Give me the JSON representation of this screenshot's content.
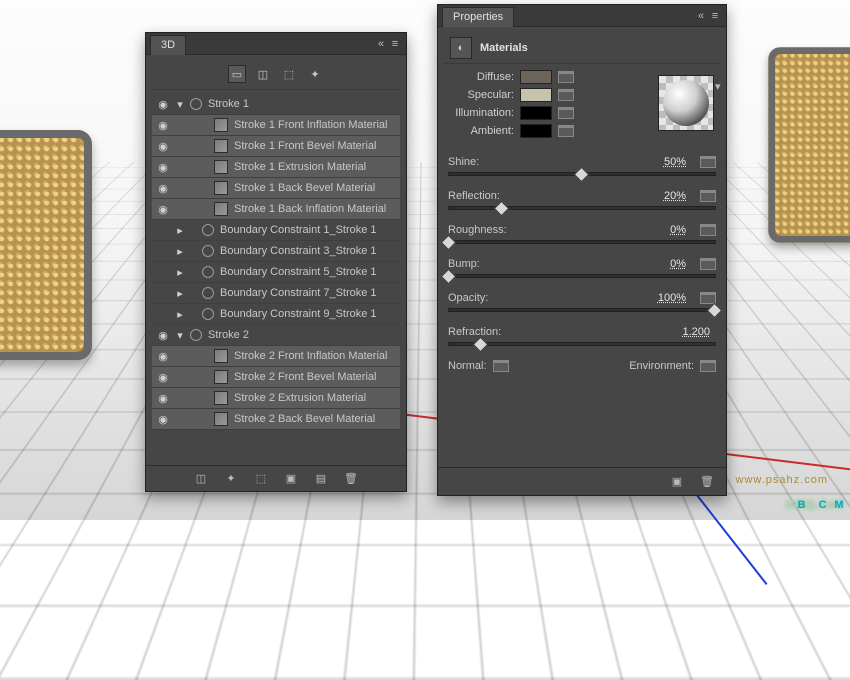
{
  "watermark_main": "UiBQ.CoM",
  "watermark_sub": "www.psahz.com",
  "panels": {
    "threeD": {
      "tab": "3D",
      "tree": [
        {
          "eye": true,
          "chv": "v",
          "depth": 0,
          "icon": "mesh",
          "label": "Stroke 1",
          "sel": false
        },
        {
          "eye": true,
          "chv": "",
          "depth": 2,
          "icon": "mat",
          "label": "Stroke 1 Front Inflation Material",
          "sel": true
        },
        {
          "eye": true,
          "chv": "",
          "depth": 2,
          "icon": "mat",
          "label": "Stroke 1 Front Bevel Material",
          "sel": true
        },
        {
          "eye": true,
          "chv": "",
          "depth": 2,
          "icon": "mat",
          "label": "Stroke 1 Extrusion Material",
          "sel": true
        },
        {
          "eye": true,
          "chv": "",
          "depth": 2,
          "icon": "mat",
          "label": "Stroke 1 Back Bevel Material",
          "sel": true
        },
        {
          "eye": true,
          "chv": "",
          "depth": 2,
          "icon": "mat",
          "label": "Stroke 1 Back Inflation Material",
          "sel": true
        },
        {
          "eye": false,
          "chv": ">",
          "depth": 1,
          "icon": "mesh",
          "label": "Boundary Constraint 1_Stroke 1",
          "sel": false
        },
        {
          "eye": false,
          "chv": ">",
          "depth": 1,
          "icon": "mesh",
          "label": "Boundary Constraint 3_Stroke 1",
          "sel": false
        },
        {
          "eye": false,
          "chv": ">",
          "depth": 1,
          "icon": "mesh",
          "label": "Boundary Constraint 5_Stroke 1",
          "sel": false
        },
        {
          "eye": false,
          "chv": ">",
          "depth": 1,
          "icon": "mesh",
          "label": "Boundary Constraint 7_Stroke 1",
          "sel": false
        },
        {
          "eye": false,
          "chv": ">",
          "depth": 1,
          "icon": "mesh",
          "label": "Boundary Constraint 9_Stroke 1",
          "sel": false
        },
        {
          "eye": true,
          "chv": "v",
          "depth": 0,
          "icon": "mesh",
          "label": "Stroke 2",
          "sel": false
        },
        {
          "eye": true,
          "chv": "",
          "depth": 2,
          "icon": "mat",
          "label": "Stroke 2 Front Inflation Material",
          "sel": true
        },
        {
          "eye": true,
          "chv": "",
          "depth": 2,
          "icon": "mat",
          "label": "Stroke 2 Front Bevel Material",
          "sel": true
        },
        {
          "eye": true,
          "chv": "",
          "depth": 2,
          "icon": "mat",
          "label": "Stroke 2 Extrusion Material",
          "sel": true
        },
        {
          "eye": true,
          "chv": "",
          "depth": 2,
          "icon": "mat",
          "label": "Stroke 2 Back Bevel Material",
          "sel": true
        }
      ]
    },
    "properties": {
      "tab": "Properties",
      "section": "Materials",
      "swatches": [
        {
          "name": "Diffuse:",
          "color": "#6c645a",
          "folder": true
        },
        {
          "name": "Specular:",
          "color": "#c8c3ad",
          "folder": true
        },
        {
          "name": "Illumination:",
          "color": "#000000",
          "folder": true
        },
        {
          "name": "Ambient:",
          "color": "#000000",
          "folder": true
        }
      ],
      "sliders": [
        {
          "name": "Shine:",
          "value": "50%",
          "pos": 50,
          "folder": true
        },
        {
          "name": "Reflection:",
          "value": "20%",
          "pos": 20,
          "folder": true
        },
        {
          "name": "Roughness:",
          "value": "0%",
          "pos": 0,
          "folder": true
        },
        {
          "name": "Bump:",
          "value": "0%",
          "pos": 0,
          "folder": true
        },
        {
          "name": "Opacity:",
          "value": "100%",
          "pos": 100,
          "folder": true
        },
        {
          "name": "Refraction:",
          "value": "1.200",
          "pos": 12,
          "folder": false
        }
      ],
      "bottom": {
        "normal": "Normal:",
        "env": "Environment:"
      }
    }
  }
}
